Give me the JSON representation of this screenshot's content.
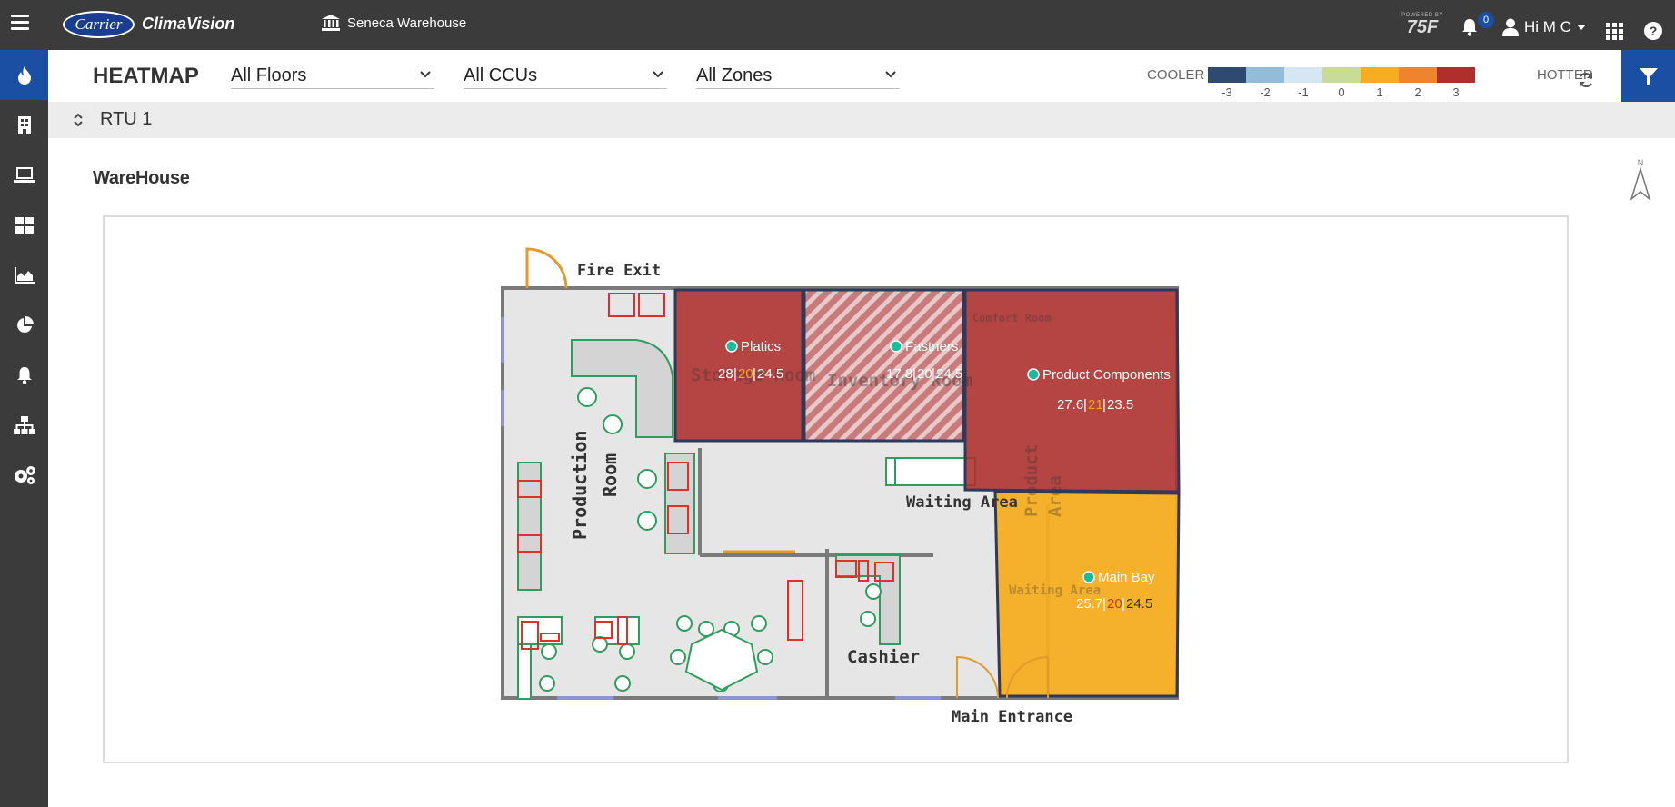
{
  "topbar": {
    "brand_logo": "Carrier",
    "app_name": "ClimaVision",
    "site_name": "Seneca Warehouse",
    "powered_by": "POWERED BY",
    "powered_brand": "75F",
    "notifications_count": "0",
    "greeting": "Hi  M C"
  },
  "sidebar": {
    "items": [
      {
        "icon": "flame-icon",
        "active": true
      },
      {
        "icon": "building-icon"
      },
      {
        "icon": "laptop-icon"
      },
      {
        "icon": "dashboard-icon"
      },
      {
        "icon": "area-chart-icon"
      },
      {
        "icon": "pie-chart-icon"
      },
      {
        "icon": "bell-icon"
      },
      {
        "icon": "sitemap-icon"
      },
      {
        "icon": "cogs-icon"
      }
    ]
  },
  "header": {
    "title": "HEATMAP",
    "floors": "All Floors",
    "ccus": "All CCUs",
    "zones": "All Zones",
    "legend": {
      "cooler_label": "COOLER",
      "hotter_label": "HOTTER",
      "scale": [
        {
          "value": "-3",
          "color": "#2f4a72"
        },
        {
          "value": "-2",
          "color": "#92bcd8"
        },
        {
          "value": "-1",
          "color": "#d6e6f2"
        },
        {
          "value": "0",
          "color": "#c8dc98"
        },
        {
          "value": "1",
          "color": "#f6ad22"
        },
        {
          "value": "2",
          "color": "#ee8430"
        },
        {
          "value": "3",
          "color": "#ae2f2c"
        }
      ]
    }
  },
  "subheader": {
    "rtu": "RTU 1"
  },
  "floorplan": {
    "name": "WareHouse",
    "compass": "N",
    "labels": {
      "fire_exit": "Fire Exit",
      "production_room_1": "Production",
      "production_room_2": "Room",
      "waiting_area": "Waiting Area",
      "cashier": "Cashier",
      "main_entrance": "Main Entrance",
      "storage_room": "Storage Room",
      "inventory_room": "Inventory Room",
      "comfort_room": "Comfort Room",
      "product_area_1": "Product",
      "product_area_2": "Area",
      "waiting_area_2": "Waiting Area"
    },
    "zones": [
      {
        "name": "Platics",
        "current": "28",
        "desired": "20",
        "setpoint": "24.5",
        "color": "#ae2f2c"
      },
      {
        "name": "Fastners",
        "current": "17.8",
        "desired": "20",
        "setpoint": "24.5",
        "color": "#ae2f2c"
      },
      {
        "name": "Product Components",
        "current": "27.6",
        "desired": "21",
        "setpoint": "23.5",
        "color": "#ae2f2c"
      },
      {
        "name": "Main Bay",
        "current": "25.7",
        "desired": "20",
        "setpoint": "24.5",
        "color": "#f6ad22"
      }
    ]
  }
}
